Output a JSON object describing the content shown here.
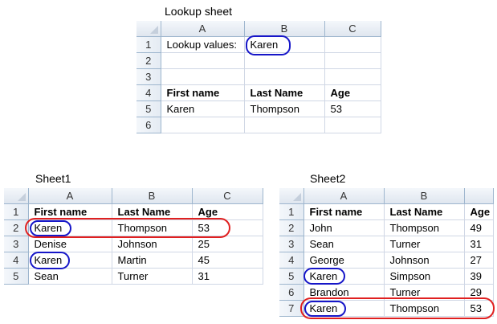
{
  "lookup": {
    "title": "Lookup sheet",
    "columns": [
      "A",
      "B",
      "C"
    ],
    "rows": [
      {
        "num": "1",
        "cells": [
          "Lookup values:",
          "Karen",
          ""
        ]
      },
      {
        "num": "2",
        "cells": [
          "",
          "",
          ""
        ]
      },
      {
        "num": "3",
        "cells": [
          "",
          "",
          ""
        ]
      },
      {
        "num": "4",
        "cells": [
          "First name",
          "Last Name",
          "Age"
        ]
      },
      {
        "num": "5",
        "cells": [
          "Karen",
          "Thompson",
          "53"
        ]
      },
      {
        "num": "6",
        "cells": [
          "",
          "",
          ""
        ]
      }
    ]
  },
  "sheet1": {
    "title": "Sheet1",
    "columns": [
      "A",
      "B",
      "C"
    ],
    "rows": [
      {
        "num": "1",
        "cells": [
          "First name",
          "Last Name",
          "Age"
        ]
      },
      {
        "num": "2",
        "cells": [
          "Karen",
          "Thompson",
          "53"
        ]
      },
      {
        "num": "3",
        "cells": [
          "Denise",
          "Johnson",
          "25"
        ]
      },
      {
        "num": "4",
        "cells": [
          "Karen",
          "Martin",
          "45"
        ]
      },
      {
        "num": "5",
        "cells": [
          "Sean",
          "Turner",
          "31"
        ]
      }
    ]
  },
  "sheet2": {
    "title": "Sheet2",
    "columns": [
      "A",
      "B",
      ""
    ],
    "rows": [
      {
        "num": "1",
        "cells": [
          "First name",
          "Last Name",
          "Age"
        ]
      },
      {
        "num": "2",
        "cells": [
          "John",
          "Thompson",
          "49"
        ]
      },
      {
        "num": "3",
        "cells": [
          "Sean",
          "Turner",
          "31"
        ]
      },
      {
        "num": "4",
        "cells": [
          "George",
          "Johnson",
          "27"
        ]
      },
      {
        "num": "5",
        "cells": [
          "Karen",
          "Simpson",
          "39"
        ]
      },
      {
        "num": "6",
        "cells": [
          "Brandon",
          "Turner",
          "29"
        ]
      },
      {
        "num": "7",
        "cells": [
          "Karen",
          "Thompson",
          "53"
        ]
      }
    ]
  },
  "colors": {
    "blue_circle": "#1616c8",
    "red_circle": "#e02020",
    "header_bg": "#dfe6ef",
    "gridline": "#d0d7e5"
  }
}
